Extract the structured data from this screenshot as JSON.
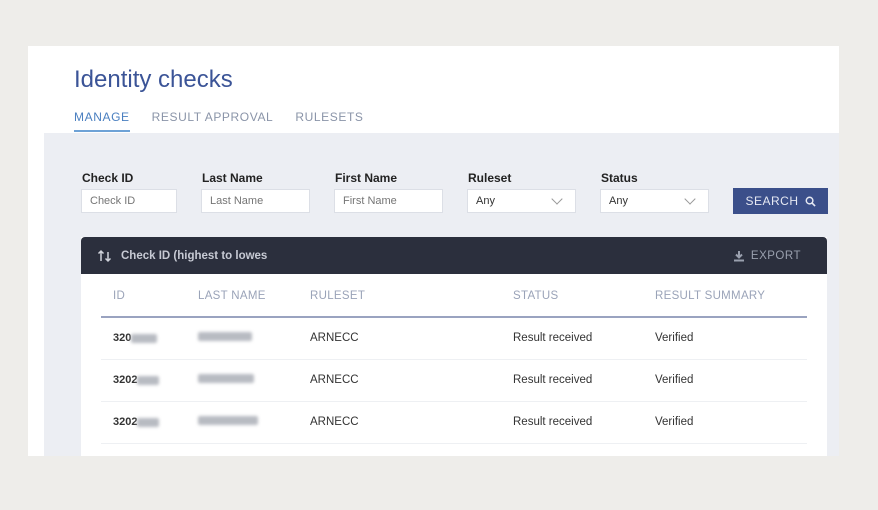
{
  "title": "Identity checks",
  "tabs": [
    {
      "label": "MANAGE",
      "active": true
    },
    {
      "label": "RESULT APPROVAL"
    },
    {
      "label": "RULESETS"
    }
  ],
  "filters": {
    "check_id": {
      "label": "Check ID",
      "placeholder": "Check ID"
    },
    "last_name": {
      "label": "Last Name",
      "placeholder": "Last Name"
    },
    "first_name": {
      "label": "First Name",
      "placeholder": "First Name"
    },
    "ruleset": {
      "label": "Ruleset",
      "value": "Any"
    },
    "status": {
      "label": "Status",
      "value": "Any"
    },
    "search_label": "SEARCH"
  },
  "table": {
    "sort_label": "Check ID (highest to lowes",
    "export_label": "EXPORT",
    "columns": [
      "ID",
      "LAST NAME",
      "RULESET",
      "STATUS",
      "RESULT SUMMARY"
    ],
    "rows": [
      {
        "id": "320",
        "ruleset": "ARNECC",
        "status": "Result received",
        "summary": "Verified"
      },
      {
        "id": "3202",
        "ruleset": "ARNECC",
        "status": "Result received",
        "summary": "Verified"
      },
      {
        "id": "3202",
        "ruleset": "ARNECC",
        "status": "Result received",
        "summary": "Verified"
      }
    ]
  }
}
